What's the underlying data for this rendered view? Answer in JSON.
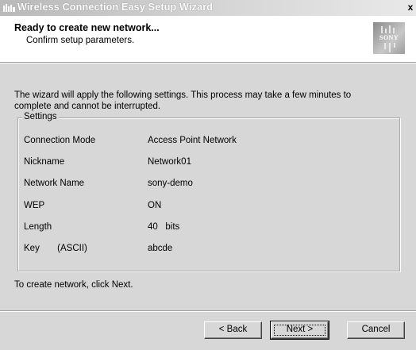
{
  "window": {
    "title": "Wireless Connection Easy Setup Wizard",
    "close_glyph": "x"
  },
  "header": {
    "title": "Ready to create new network...",
    "subtitle": "Confirm setup parameters.",
    "logo_text": "SONY"
  },
  "intro": "The wizard will apply the following settings. This process may take a few minutes to complete and cannot be interrupted.",
  "settings": {
    "legend": "Settings",
    "rows": [
      {
        "label": "Connection Mode",
        "value": "Access Point Network"
      },
      {
        "label": "Nickname",
        "value": "Network01"
      },
      {
        "label": "Network Name",
        "value": "sony-demo"
      },
      {
        "label": "WEP",
        "value": "ON"
      },
      {
        "label": "Length",
        "value": "40   bits"
      },
      {
        "label": "Key       (ASCII)",
        "value": "abcde"
      }
    ]
  },
  "footer_note": "To create network, click Next.",
  "buttons": {
    "back": "< Back",
    "next": "Next >",
    "cancel": "Cancel"
  }
}
